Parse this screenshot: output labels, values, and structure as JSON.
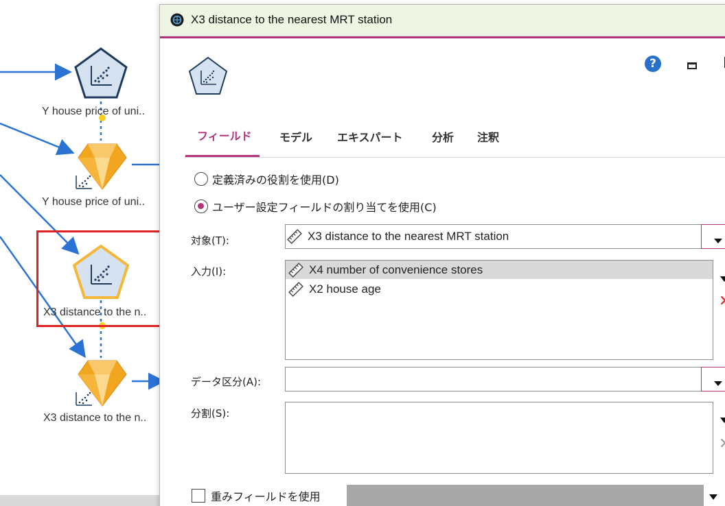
{
  "canvas": {
    "nodes": [
      {
        "label": "Y house price of uni..",
        "type": "source"
      },
      {
        "label": "Y house price of uni..",
        "type": "model"
      },
      {
        "label": "X3 distance to the n..",
        "type": "source",
        "selected": true
      },
      {
        "label": "X3 distance to the n..",
        "type": "model"
      }
    ]
  },
  "dialog": {
    "title": "X3 distance to the nearest MRT station",
    "help_glyph": "?",
    "tabs": [
      {
        "label": "フィールド",
        "active": true
      },
      {
        "label": "モデル",
        "active": false
      },
      {
        "label": "エキスパート",
        "active": false
      },
      {
        "label": "分析",
        "active": false
      },
      {
        "label": "注釈",
        "active": false
      }
    ],
    "radios": {
      "predefined": {
        "label": "定義済みの役割を使用(D)",
        "checked": false
      },
      "custom": {
        "label": "ユーザー設定フィールドの割り当てを使用(C)",
        "checked": true
      }
    },
    "target": {
      "label": "対象(T):",
      "value": "X3 distance to the nearest MRT station"
    },
    "inputs": {
      "label": "入力(I):",
      "items": [
        {
          "name": "X4 number of convenience stores",
          "selected": true
        },
        {
          "name": "X2 house age",
          "selected": false
        }
      ]
    },
    "partition": {
      "label": "データ区分(A):",
      "value": ""
    },
    "split": {
      "label": "分割(S):"
    },
    "weight": {
      "label": "重みフィールドを使用",
      "checked": false
    }
  },
  "colors": {
    "accent": "#b1347a",
    "titlebar": "#eef5e3",
    "node_blue": "#2a72d4",
    "model_gold": "#f2a51f",
    "selection_red": "#e02020"
  },
  "icons": [
    "app-icon",
    "help-icon",
    "minimize-icon",
    "maximize-icon",
    "scatter-node-icon",
    "nugget-icon",
    "ruler-icon",
    "dropdown-arrow-icon",
    "delete-x-icon"
  ]
}
